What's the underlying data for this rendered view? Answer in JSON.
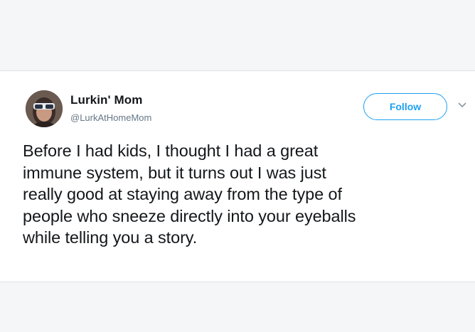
{
  "tweet": {
    "author": {
      "display_name": "Lurkin' Mom",
      "handle": "@LurkAtHomeMom",
      "avatar_icon": "user-avatar-photo"
    },
    "follow_label": "Follow",
    "menu_icon": "chevron-down-icon",
    "text_lines": [
      "Before I had kids, I thought I had a great",
      "immune system, but it turns out I was just",
      "really good at staying away from the type of",
      "people who sneeze directly into your eyeballs",
      "while telling you a story."
    ]
  },
  "colors": {
    "accent": "#1da1f2",
    "text": "#14171a",
    "secondary_text": "#657786",
    "background": "#f5f6f7",
    "card": "#ffffff"
  }
}
